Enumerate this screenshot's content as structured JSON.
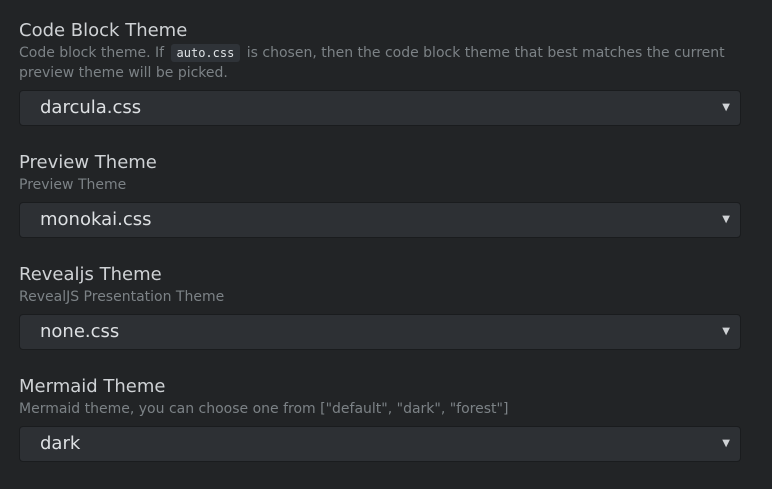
{
  "settings": [
    {
      "title": "Code Block Theme",
      "description_before": "Code block theme. If ",
      "description_code": "auto.css",
      "description_after": " is chosen, then the code block theme that best matches the current preview theme will be picked.",
      "value": "darcula.css"
    },
    {
      "title": "Preview Theme",
      "description": "Preview Theme",
      "value": "monokai.css"
    },
    {
      "title": "Revealjs Theme",
      "description": "RevealJS Presentation Theme",
      "value": "none.css"
    },
    {
      "title": "Mermaid Theme",
      "description": "Mermaid theme, you can choose one from [\"default\", \"dark\", \"forest\"]",
      "value": "dark"
    }
  ],
  "icons": {
    "dropdown_arrow": "▼"
  },
  "colors": {
    "background": "#222426",
    "select_background": "#2d3034",
    "title_text": "#cfd2d5",
    "description_text": "#7c8286"
  }
}
